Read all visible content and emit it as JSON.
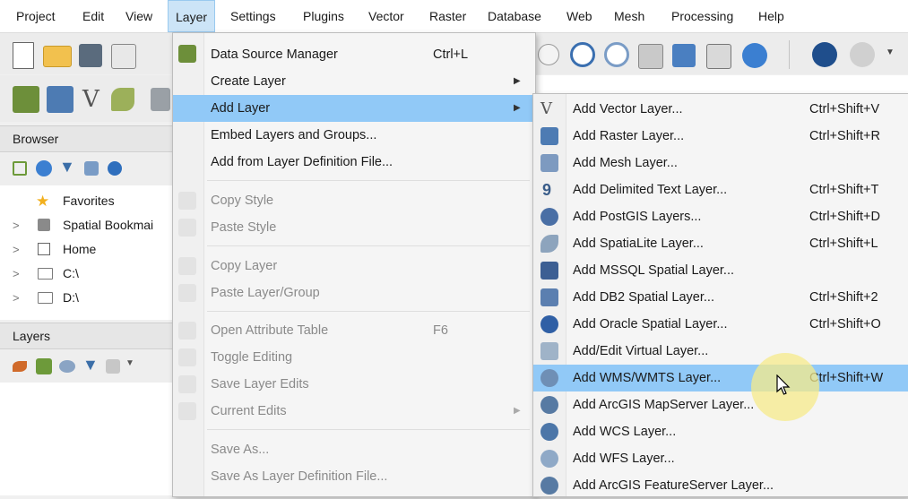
{
  "menubar": {
    "items": [
      "Project",
      "Edit",
      "View",
      "Layer",
      "Settings",
      "Plugins",
      "Vector",
      "Raster",
      "Database",
      "Web",
      "Mesh",
      "Processing",
      "Help"
    ],
    "active": "Layer"
  },
  "browser_panel": {
    "title": "Browser",
    "items": [
      {
        "label": "Favorites",
        "icon": "star-icon"
      },
      {
        "label": "Spatial Bookmai",
        "icon": "bookmark-icon"
      },
      {
        "label": "Home",
        "icon": "home-icon"
      },
      {
        "label": "C:\\",
        "icon": "drive-icon"
      },
      {
        "label": "D:\\",
        "icon": "drive-icon"
      }
    ]
  },
  "layers_panel": {
    "title": "Layers"
  },
  "layer_menu": {
    "items": [
      {
        "label": "Data Source Manager",
        "shortcut": "Ctrl+L",
        "enabled": true
      },
      {
        "label": "Create Layer",
        "submenu": true,
        "enabled": true
      },
      {
        "label": "Add Layer",
        "submenu": true,
        "enabled": true,
        "highlighted": true
      },
      {
        "label": "Embed Layers and Groups...",
        "enabled": true
      },
      {
        "label": "Add from Layer Definition File...",
        "enabled": true
      },
      {
        "label": "Copy Style",
        "enabled": false
      },
      {
        "label": "Paste Style",
        "enabled": false
      },
      {
        "label": "Copy Layer",
        "enabled": false
      },
      {
        "label": "Paste Layer/Group",
        "enabled": false
      },
      {
        "label": "Open Attribute Table",
        "shortcut": "F6",
        "enabled": false
      },
      {
        "label": "Toggle Editing",
        "enabled": false
      },
      {
        "label": "Save Layer Edits",
        "enabled": false
      },
      {
        "label": "Current Edits",
        "submenu": true,
        "enabled": false
      },
      {
        "label": "Save As...",
        "enabled": false
      },
      {
        "label": "Save As Layer Definition File...",
        "enabled": false
      }
    ]
  },
  "add_layer_submenu": {
    "items": [
      {
        "label": "Add Vector Layer...",
        "shortcut": "Ctrl+Shift+V"
      },
      {
        "label": "Add Raster Layer...",
        "shortcut": "Ctrl+Shift+R"
      },
      {
        "label": "Add Mesh Layer..."
      },
      {
        "label": "Add Delimited Text Layer...",
        "shortcut": "Ctrl+Shift+T"
      },
      {
        "label": "Add PostGIS Layers...",
        "shortcut": "Ctrl+Shift+D"
      },
      {
        "label": "Add SpatiaLite Layer...",
        "shortcut": "Ctrl+Shift+L"
      },
      {
        "label": "Add MSSQL Spatial Layer..."
      },
      {
        "label": "Add DB2 Spatial Layer...",
        "shortcut": "Ctrl+Shift+2"
      },
      {
        "label": "Add Oracle Spatial Layer...",
        "shortcut": "Ctrl+Shift+O"
      },
      {
        "label": "Add/Edit Virtual Layer..."
      },
      {
        "label": "Add WMS/WMTS Layer...",
        "shortcut": "Ctrl+Shift+W",
        "highlighted": true
      },
      {
        "label": "Add ArcGIS MapServer Layer..."
      },
      {
        "label": "Add WCS Layer..."
      },
      {
        "label": "Add WFS Layer..."
      },
      {
        "label": "Add ArcGIS FeatureServer Layer..."
      }
    ]
  },
  "colors": {
    "menu_highlight": "#91c9f7",
    "menubar_active": "#cce4f7",
    "cursor_halo": "#f5e98a"
  }
}
